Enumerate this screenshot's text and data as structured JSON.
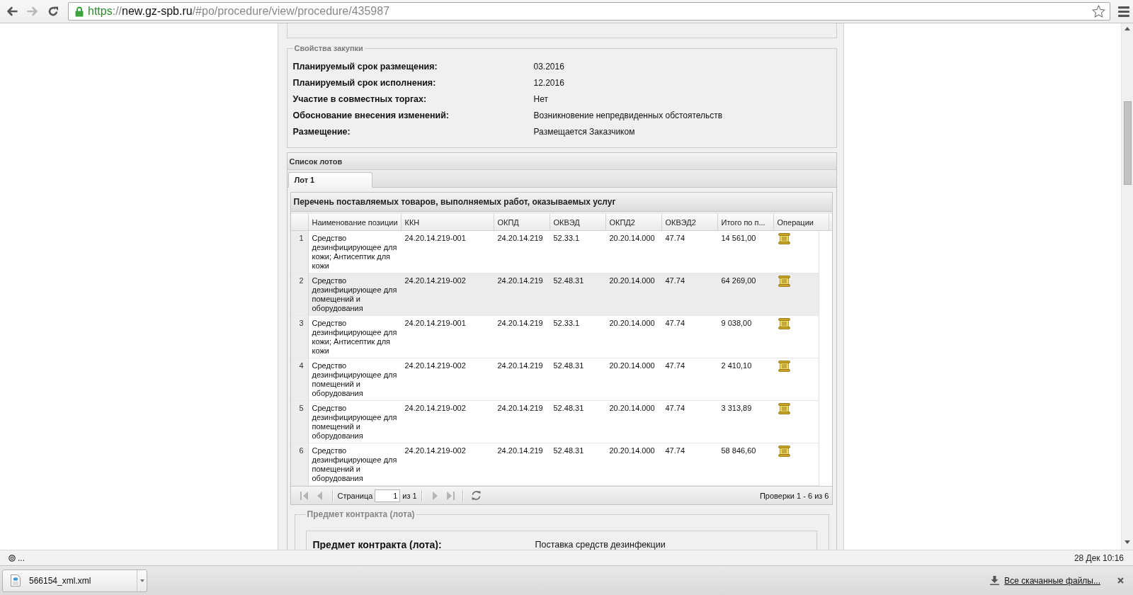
{
  "browser": {
    "nav": {
      "back_disabled": false,
      "forward_disabled": true
    },
    "address": {
      "scheme": "https",
      "separator": "://",
      "host": "new.gz-spb.ru",
      "path": "/#po/procedure/view/procedure/435987"
    }
  },
  "properties": {
    "legend": "Свойства закупки",
    "rows": [
      {
        "label": "Планируемый срок размещения:",
        "value": "03.2016"
      },
      {
        "label": "Планируемый срок исполнения:",
        "value": "12.2016"
      },
      {
        "label": "Участие в совместных торгах:",
        "value": "Нет"
      },
      {
        "label": "Обоснование внесения изменений:",
        "value": "Возникновение непредвиденных обстоятельств"
      },
      {
        "label": "Размещение:",
        "value": "Размещается Заказчиком"
      }
    ]
  },
  "lots": {
    "title": "Список лотов",
    "tabs": [
      {
        "label": "Лот 1",
        "selected": true
      }
    ],
    "grid": {
      "title": "Перечень поставляемых товаров, выполняемых работ, оказываемых услуг",
      "columns": [
        "Наименование позиции",
        "ККН",
        "ОКПД",
        "ОКВЭД",
        "ОКПД2",
        "ОКВЭД2",
        "Итого по п...",
        "Операции"
      ],
      "rows": [
        {
          "number": "1",
          "cells": [
            "Средство дезинфицирующее для кожи; Антисептик для кожи",
            "24.20.14.219-001",
            "24.20.14.219",
            "52.33.1",
            "20.20.14.000",
            "47.74",
            "14 561,00"
          ],
          "selected": false
        },
        {
          "number": "2",
          "cells": [
            "Средство дезинфицирующее для помещений и оборудования",
            "24.20.14.219-002",
            "24.20.14.219",
            "52.48.31",
            "20.20.14.000",
            "47.74",
            "64 269,00"
          ],
          "selected": true
        },
        {
          "number": "3",
          "cells": [
            "Средство дезинфицирующее для кожи; Антисептик для кожи",
            "24.20.14.219-001",
            "24.20.14.219",
            "52.33.1",
            "20.20.14.000",
            "47.74",
            "9 038,00"
          ],
          "selected": false
        },
        {
          "number": "4",
          "cells": [
            "Средство дезинфицирующее для помещений и оборудования",
            "24.20.14.219-002",
            "24.20.14.219",
            "52.48.31",
            "20.20.14.000",
            "47.74",
            "2 410,10"
          ],
          "selected": false
        },
        {
          "number": "5",
          "cells": [
            "Средство дезинфицирующее для помещений и оборудования",
            "24.20.14.219-002",
            "24.20.14.219",
            "52.48.31",
            "20.20.14.000",
            "47.74",
            "3 313,89"
          ],
          "selected": false
        },
        {
          "number": "6",
          "cells": [
            "Средство дезинфицирующее для помещений и оборудования",
            "24.20.14.219-002",
            "24.20.14.219",
            "52.48.31",
            "20.20.14.000",
            "47.74",
            "58 846,60"
          ],
          "selected": false
        }
      ],
      "pager": {
        "page_label": "Страница",
        "page": "1",
        "page_count": "из 1",
        "nav_disabled": true,
        "summary": "Проверки 1 - 6 из 6"
      }
    },
    "contract": {
      "legend": "Предмет контракта (лота)",
      "label": "Предмет контракта (лота):",
      "value": "Поставка средств дезинфекции"
    }
  },
  "status_bar": {
    "text": "...",
    "clock": "28 Дек 10:16"
  },
  "downloads": {
    "items": [
      {
        "filename": "566154_xml.xml"
      }
    ],
    "show_all": "Все скачанные файлы..."
  }
}
